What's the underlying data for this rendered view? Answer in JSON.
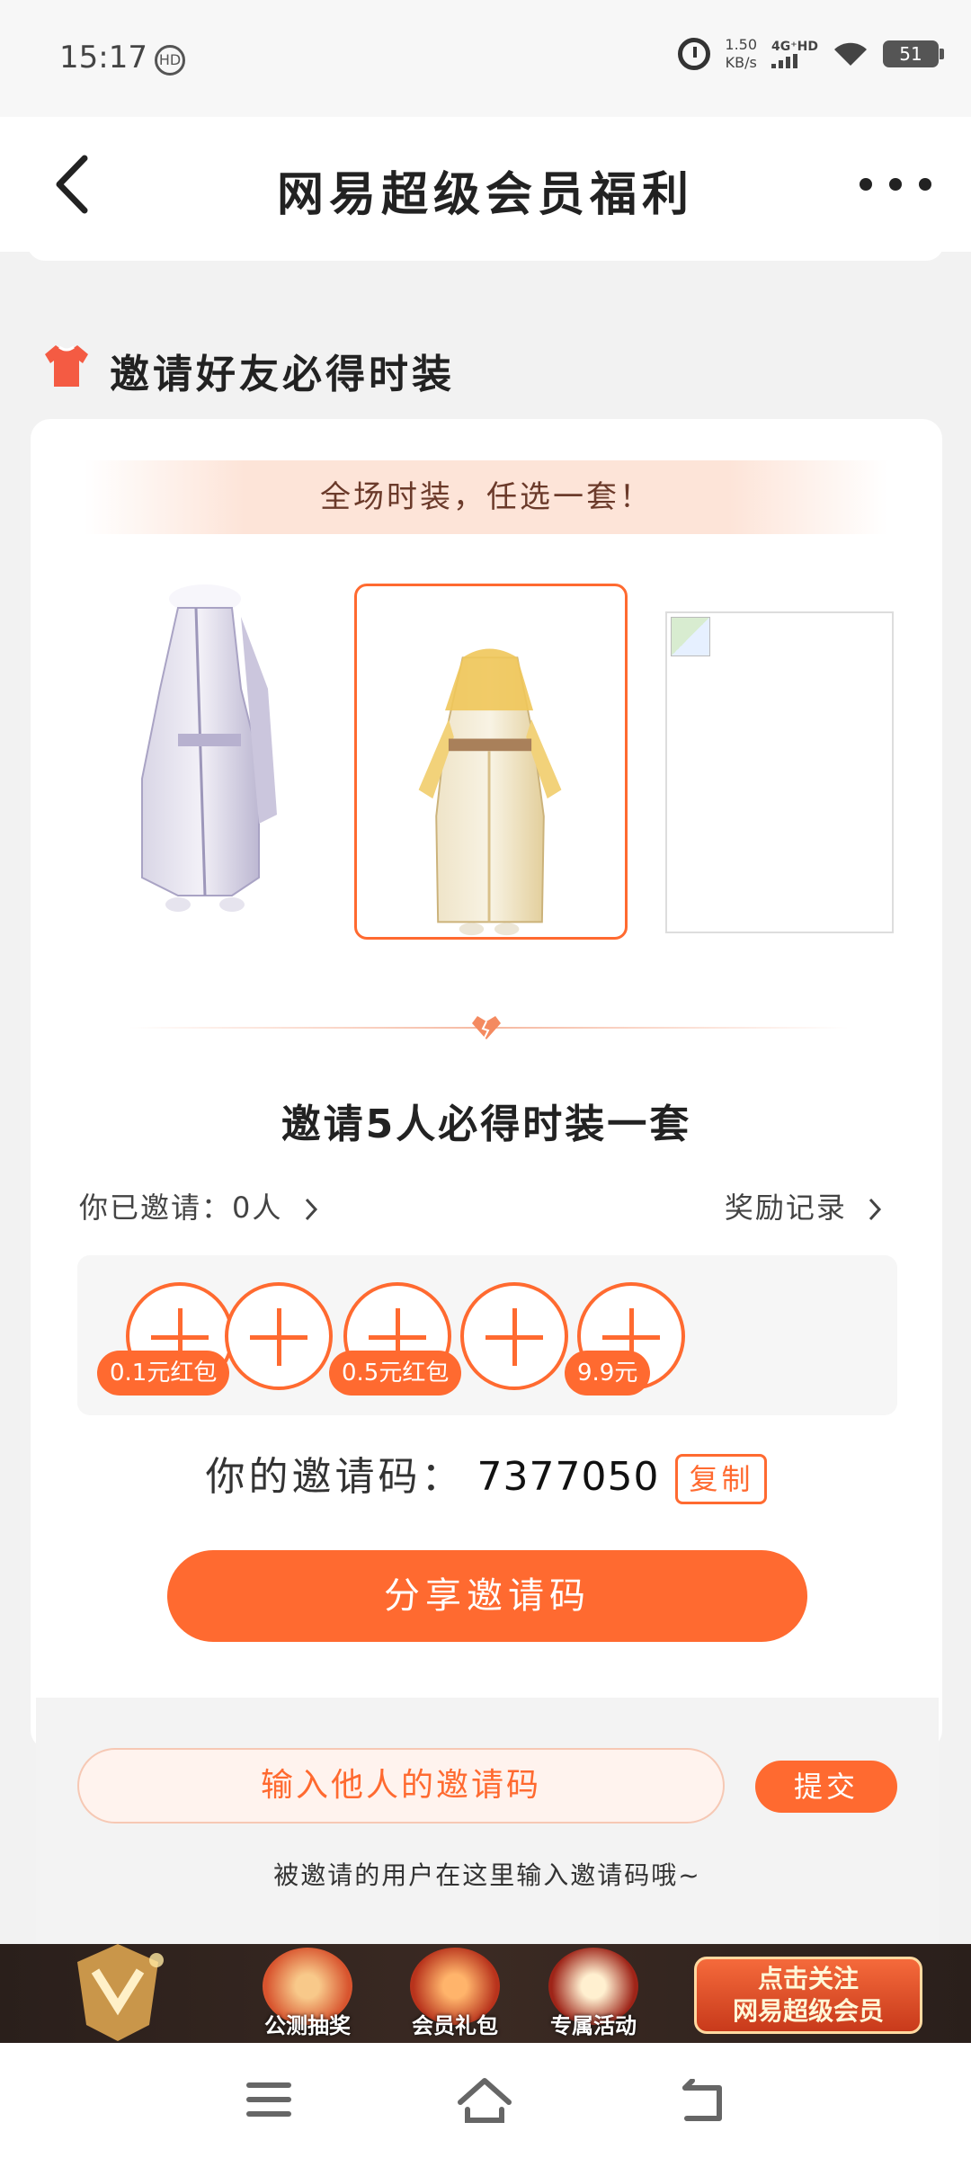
{
  "status": {
    "time": "15:17",
    "hd": "HD",
    "speed_value": "1.50",
    "speed_unit": "KB/s",
    "network": "4G⁺HD",
    "battery": "51"
  },
  "navbar": {
    "title": "网易超级会员福利"
  },
  "section": {
    "title": "邀请好友必得时装"
  },
  "card": {
    "banner": "全场时装，任选一套！",
    "invite_title": "邀请5人必得时装一套",
    "invited": "你已邀请：0人",
    "reward_record": "奖励记录",
    "slots": [
      {
        "tag": "0.1元红包"
      },
      {
        "tag": ""
      },
      {
        "tag": "0.5元红包"
      },
      {
        "tag": ""
      },
      {
        "tag": "9.9元"
      }
    ],
    "code_label": "你的邀请码：",
    "code_value": "7377050",
    "copy_label": "复制",
    "share_label": "分享邀请码"
  },
  "lower": {
    "input_placeholder": "输入他人的邀请码",
    "submit_label": "提交",
    "hint": "被邀请的用户在这里输入邀请码哦~"
  },
  "promo": {
    "items": [
      "公测抽奖",
      "会员礼包",
      "专属活动"
    ],
    "cta_line1": "点击关注",
    "cta_line2": "网易超级会员"
  },
  "colors": {
    "accent": "#ff6a30",
    "banner_bg": "#fde4d8",
    "promo_bg": "#2a1f1b"
  }
}
